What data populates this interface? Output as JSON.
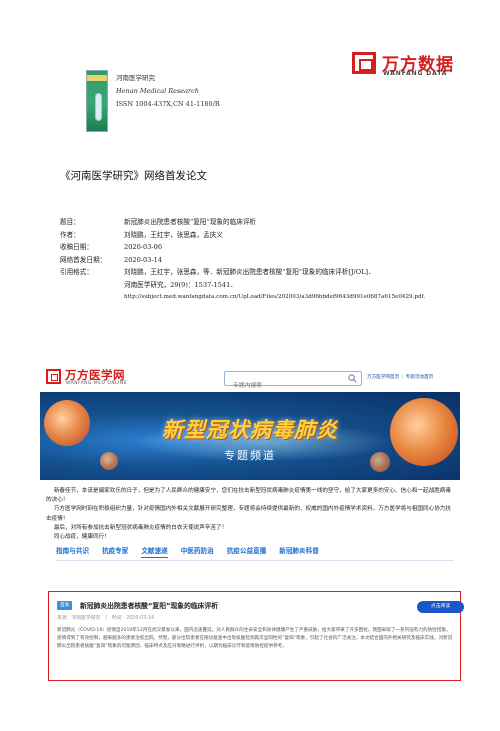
{
  "cover": {
    "journal_cn": "河南医学研究",
    "journal_en": "Henan Medical Research",
    "issn": "ISSN 1004-437X,CN 41-1180/R"
  },
  "wanfang_logo": {
    "cn": "万方数据",
    "en": "WANFANG DATA",
    "color": "#d71e1e"
  },
  "doc_title": "《河南医学研究》网络首发论文",
  "meta": {
    "title_label": "题目：",
    "title_value": "新冠肺炎出院患者核酸“复阳”现象的临床评析",
    "author_label": "作者：",
    "author_value": "刘晓鹏，王红宇，张思森，孟庆义",
    "received_label": "收稿日期：",
    "received_value": "2020-03-06",
    "online_label": "网络首发日期：",
    "online_value": "2020-03-14",
    "citation_label": "引用格式：",
    "citation_line1": "刘晓鹏，王红宇，张思森，等．新冠肺炎出院患者核酸“复阳”现象的临床评析[J/OL]．",
    "citation_line2": "河南医学研究，29(9)：1537-1541．",
    "citation_url": "http://subject.med.wanfangdata.com.cn/UpLoad/Files/202003/a3d96bbdef9643d991e0687a615e0429.pdf."
  },
  "promo": {
    "logo_cn": "万方医学网",
    "logo_en": "WANFANG MED ONLINE",
    "search_placeholder": "专题内搜索",
    "link_home": "万方医学网首页",
    "link_sep": "|",
    "link_topic_home": "专题活动首页",
    "banner_title": "新型冠状病毒肺炎",
    "banner_subtitle": "专题频道",
    "intro_lines": [
      "新春佳节，本该是阖家欢乐的日子，但是为了人民群众的健康安宁，您们在抗击新型冠状病毒肺炎疫情第一线的坚守，给了大家更多的安心、信心和一起战胜病毒的决心！",
      "万方医学网时刻在积极组织力量，针对疫情国内外相关文献展开研究整理，专题将会持续提供最新的、权威的国内外疫情学术资料，万方医学将与祖国同心协力抗击疫情！",
      "最后，对所有参加抗击新型冠状病毒肺炎疫情的白衣天使说声辛苦了！",
      "同心战疫，健康同行！"
    ],
    "tabs": [
      "指南与共识",
      "抗疫专家",
      "文献速递",
      "中医药防治",
      "抗疫公益直播",
      "新冠肺炎科普"
    ],
    "active_tab": 2,
    "accent_color": "#1c6fd0"
  },
  "article": {
    "badge": "首发",
    "title": "新冠肺炎出院患者核酸“复阳”现象的临床评析",
    "source_label": "来源：河南医学研究",
    "date_label": "时间：2020-03-14",
    "read_button": "点击阅读",
    "summary": "新冠肺炎（COVID-19）疫情自2019年12月在武汉暴发以来，国内迅速蔓延，对人民群众的生命安全和身体健康产生了严重威胁，给大家带来了许多困扰。我国采取了一系列强有力的防控措施，疫情得到了有效控制，越来越多的患者治愈出院。然而，部分出院患者在随访复查中出现核酸检测再次呈阳性的“复阳”现象，引起了社会的广泛关注。本文结合国内外相关研究及临床实践，对新冠肺炎出院患者核酸“复阳”现象的可能原因、临床特点及应对策略进行评析，以期为临床诊疗和疫情防控提供参考。",
    "border_color": "#e01e1e"
  }
}
